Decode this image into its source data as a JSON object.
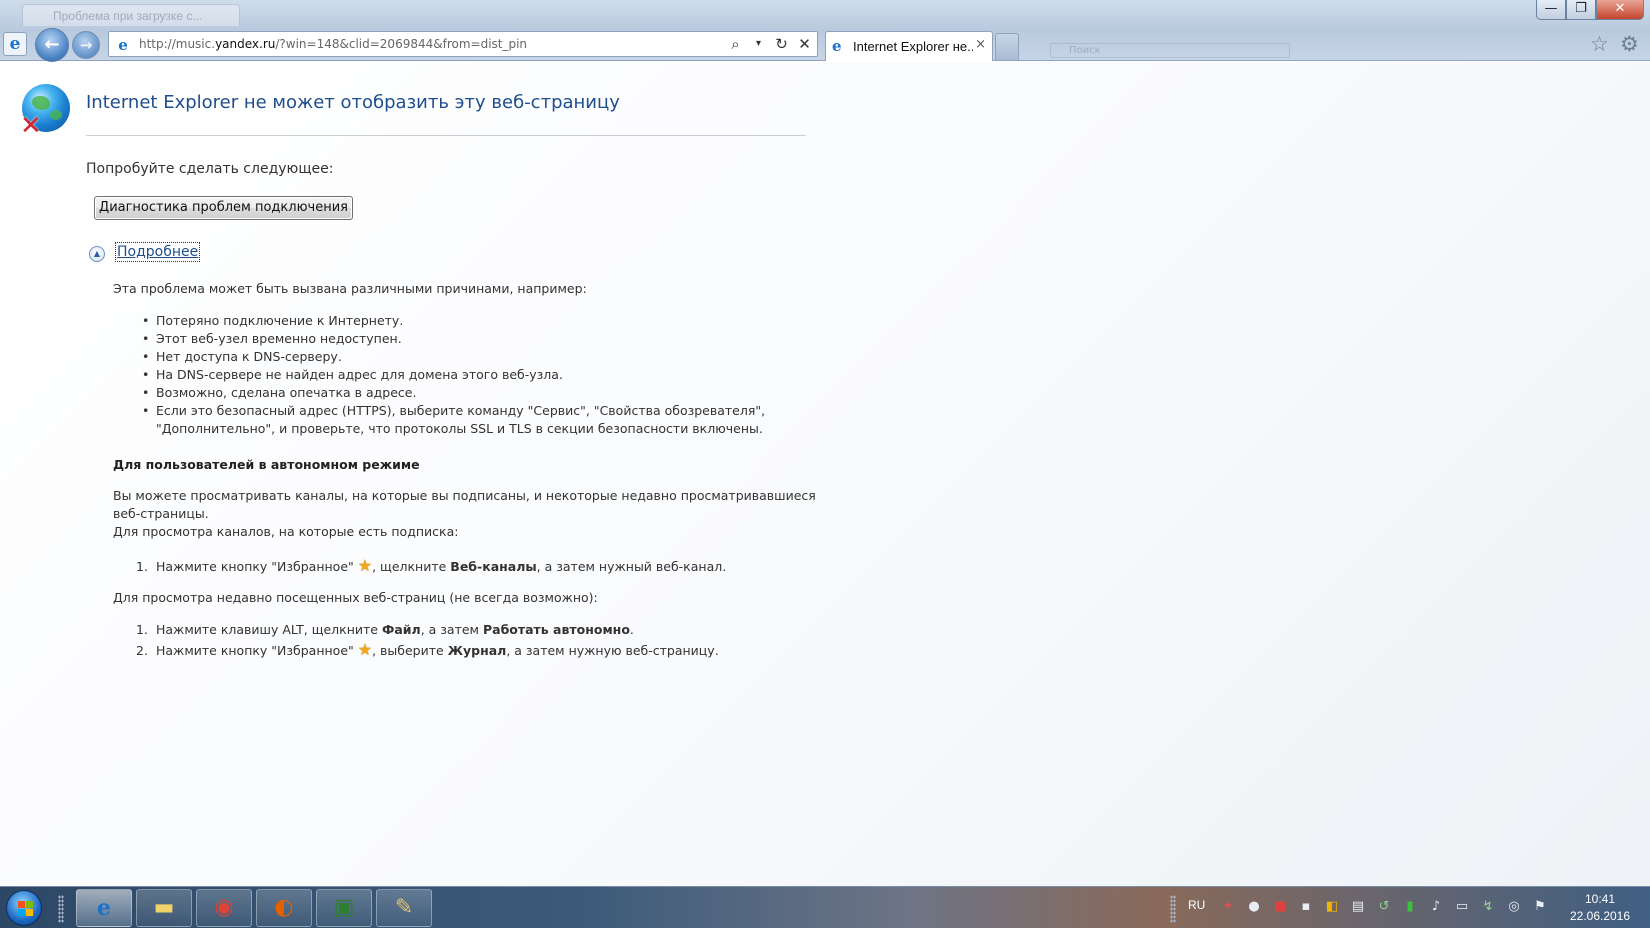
{
  "browser": {
    "ghost_tab_title": "Проблема при загрузке с...",
    "address": {
      "prefix": "http://music.",
      "domain": "yandex.ru",
      "path": "/?win=148&clid=2069844&from=dist_pin"
    },
    "address_tools": [
      "search-icon",
      "dropdown-icon",
      "refresh-icon",
      "stop-icon"
    ],
    "tab": {
      "title": "Internet Explorer не...",
      "close": "×"
    },
    "window_controls": [
      "—",
      "❐",
      "✕"
    ],
    "ghost_search": "Поиск"
  },
  "page": {
    "title": "Internet Explorer не может отобразить эту веб-страницу",
    "try_text": "Попробуйте сделать следующее:",
    "diagnose_button": "Диагностика проблем подключения",
    "more_link": "Подробнее",
    "cause_intro": "Эта проблема может быть вызвана различными причинами, например:",
    "causes": [
      "Потеряно подключение к Интернету.",
      "Этот веб-узел временно недоступен.",
      "Нет доступа к DNS-серверу.",
      "На DNS-сервере не найден адрес для домена этого веб-узла.",
      "Возможно, сделана опечатка в адресе.",
      "Если это безопасный адрес (HTTPS), выберите команду \"Сервис\", \"Свойства обозревателя\",",
      "\"Дополнительно\", и проверьте, что протоколы SSL и TLS в секции безопасности включены."
    ],
    "offline_heading": "Для пользователей в автономном режиме",
    "offline_text_1": "Вы можете просматривать каналы, на которые вы подписаны, и некоторые недавно просматривавшиеся",
    "offline_text_2": "веб-страницы.",
    "feeds_intro": "Для просмотра каналов, на которые есть подписка:",
    "feeds_steps": [
      {
        "num": "1.",
        "a": "Нажмите кнопку \"Избранное\" ",
        "b": ", щелкните ",
        "bold": "Веб-каналы",
        "c": ", а затем нужный веб-канал."
      }
    ],
    "recent_intro": "Для просмотра недавно посещенных веб-страниц (не всегда возможно):",
    "recent_steps": [
      {
        "num": "1.",
        "a": "Нажмите клавишу ALT, щелкните ",
        "bold1": "Файл",
        "b": ", а затем ",
        "bold2": "Работать автономно",
        "c": "."
      },
      {
        "num": "2.",
        "a": "Нажмите кнопку \"Избранное\" ",
        "b": ", выберите ",
        "bold": "Журнал",
        "c": ", а затем нужную веб-страницу."
      }
    ]
  },
  "taskbar": {
    "apps": [
      {
        "name": "internet-explorer",
        "glyph": "e"
      },
      {
        "name": "file-explorer",
        "glyph": "▬"
      },
      {
        "name": "chrome",
        "glyph": "◉"
      },
      {
        "name": "firefox",
        "glyph": "◐"
      },
      {
        "name": "system-monitor",
        "glyph": "▣"
      },
      {
        "name": "paint",
        "glyph": "✎"
      }
    ],
    "language": "RU",
    "time": "10:41",
    "date": "22.06.2016"
  }
}
